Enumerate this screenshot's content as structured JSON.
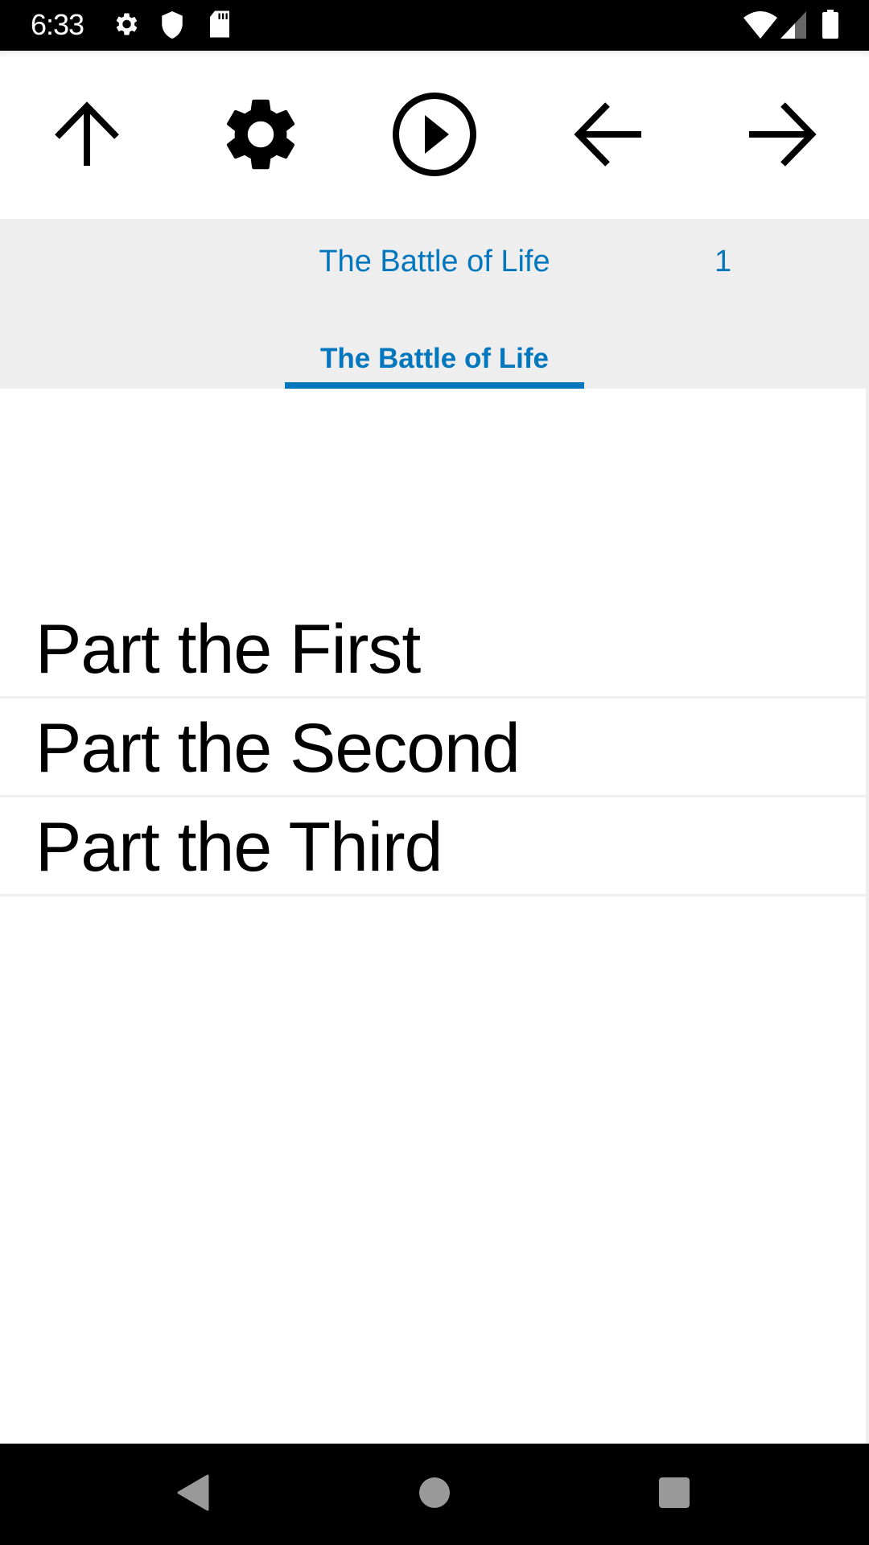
{
  "status_bar": {
    "time": "6:33",
    "left_icons": [
      "settings-icon",
      "shield-icon",
      "sd-card-icon"
    ],
    "right_icons": [
      "wifi-icon",
      "cell-signal-icon",
      "battery-icon"
    ]
  },
  "toolbar": {
    "buttons": [
      {
        "name": "up-button",
        "icon": "arrow-up-icon"
      },
      {
        "name": "settings-button",
        "icon": "gear-icon"
      },
      {
        "name": "play-button",
        "icon": "play-circle-icon"
      },
      {
        "name": "back-button",
        "icon": "arrow-left-icon"
      },
      {
        "name": "forward-button",
        "icon": "arrow-right-icon"
      }
    ]
  },
  "header": {
    "book_title": "The Battle of Life",
    "page_number": "1",
    "tab_label": "The Battle of Life",
    "accent_color": "#0277bd"
  },
  "chapters": [
    {
      "label": "Part the First"
    },
    {
      "label": "Part the Second"
    },
    {
      "label": "Part the Third"
    }
  ],
  "nav_bar": {
    "buttons": [
      "back-triangle-icon",
      "home-circle-icon",
      "recents-square-icon"
    ]
  }
}
